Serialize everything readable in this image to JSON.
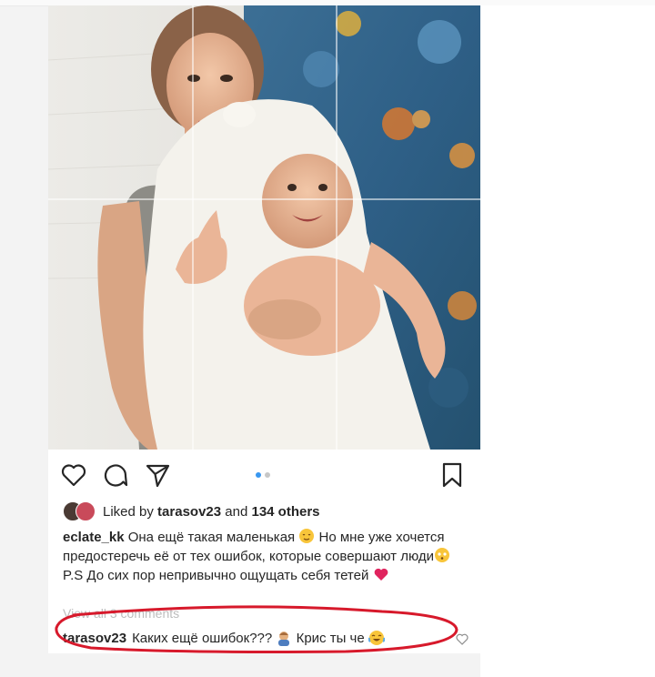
{
  "post": {
    "liked_by_prefix": "Liked by ",
    "liked_by_user": "tarasov23",
    "liked_by_and": " and ",
    "liked_by_others": "134 others",
    "caption_user": "eclate_kk",
    "caption_text": "Она ещё такая маленькая",
    "caption_text_2": " Но мне уже хочется предостеречь её от тех ошибок, которые совершают люди",
    "caption_ps": "P.S До сих пор непривычно ощущать себя тетей",
    "view_all": "View all 3 comments",
    "comment_user": "tarasov23",
    "comment_text_1": "Каких ещё ошибок???",
    "comment_text_2": "Крис ты че",
    "carousel": {
      "count": 2,
      "active": 1
    }
  },
  "icons": {
    "like": "heart-outline-icon",
    "comment": "comment-bubble-icon",
    "share": "paper-plane-icon",
    "save": "bookmark-icon",
    "comment_like": "heart-small-icon"
  },
  "colors": {
    "accent": "#3897f0",
    "text": "#262626",
    "muted": "#bdbdbd",
    "annotation": "#d7192b",
    "heart": "#e0245e"
  }
}
